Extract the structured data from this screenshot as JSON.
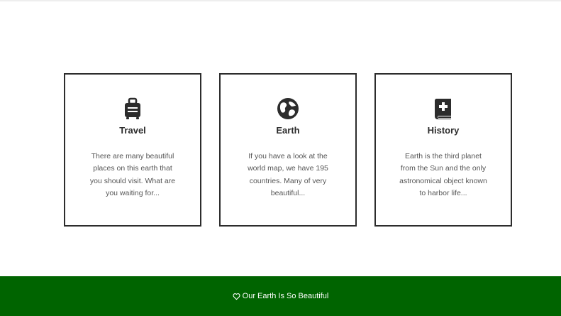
{
  "cards": [
    {
      "icon": "suitcase-icon",
      "title": "Travel",
      "text": "There are many beautiful places on this earth that you should visit. What are you waiting for..."
    },
    {
      "icon": "globe-icon",
      "title": "Earth",
      "text": "If you have a look at the world map, we have 195 countries. Many of very beautiful..."
    },
    {
      "icon": "book-medical-icon",
      "title": "History",
      "text": "Earth is the third planet from the Sun and the only astronomical object known to harbor life..."
    }
  ],
  "footer": {
    "icon": "heart-icon",
    "text": "Our Earth Is So Beautiful",
    "background": "#006400"
  },
  "colors": {
    "card_border": "#2c2c2c",
    "title_text": "#2c2c2c",
    "body_text": "#555555"
  }
}
